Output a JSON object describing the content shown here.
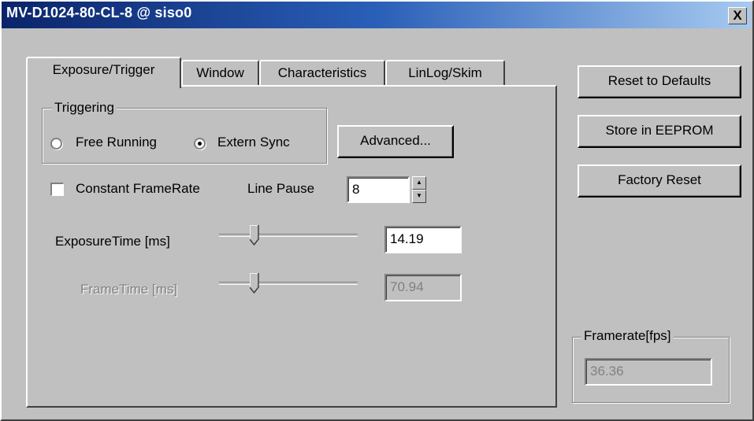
{
  "window": {
    "title": "MV-D1024-80-CL-8 @ siso0",
    "close_label": "X"
  },
  "tabs": [
    {
      "label": "Exposure/Trigger",
      "active": true
    },
    {
      "label": "Window",
      "active": false
    },
    {
      "label": "Characteristics",
      "active": false
    },
    {
      "label": "LinLog/Skim",
      "active": false
    }
  ],
  "triggering": {
    "group_label": "Triggering",
    "free_running_label": "Free Running",
    "extern_sync_label": "Extern Sync",
    "selected": "Extern Sync",
    "advanced_label": "Advanced..."
  },
  "constant_framerate": {
    "label": "Constant FrameRate",
    "checked": false
  },
  "line_pause": {
    "label": "Line Pause",
    "value": "8"
  },
  "exposure": {
    "label": "ExposureTime [ms]",
    "value": "14.19",
    "slider_fraction": 0.24
  },
  "frametime": {
    "label": "FrameTime [ms]",
    "value": "70.94",
    "slider_fraction": 0.24,
    "enabled": false
  },
  "side_buttons": {
    "reset_defaults": "Reset to Defaults",
    "store_eeprom": "Store in EEPROM",
    "factory_reset": "Factory Reset"
  },
  "framerate": {
    "group_label": "Framerate[fps]",
    "value": "36.36"
  }
}
